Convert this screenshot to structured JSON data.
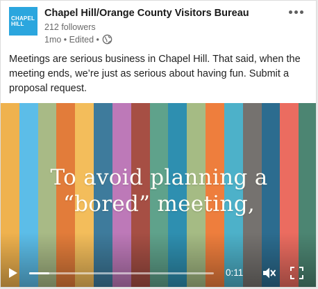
{
  "post": {
    "logo_text_line1": "CHAPEL",
    "logo_text_line2": "HILL",
    "author_name": "Chapel Hill/Orange County Visitors Bureau",
    "followers": "212 followers",
    "meta": "1mo • Edited •",
    "text": "Meetings are serious business in Chapel Hill. That said, when the meeting ends, we’re just as serious about having fun. Submit a proposal request."
  },
  "video": {
    "caption_line1": "To avoid planning a",
    "caption_line2": "“bored” meeting,",
    "time": "0:11",
    "progress": 0.11,
    "stripe_colors": [
      "#efb24e",
      "#5cbde8",
      "#a8ba86",
      "#e27c3a",
      "#f3bd5b",
      "#3e7b9c",
      "#bd79b8",
      "#a64f44",
      "#5fa28b",
      "#2e8fb0",
      "#a5bb84",
      "#ee7e3d",
      "#4db1c9",
      "#75726f",
      "#2c6c8f",
      "#eb6c60",
      "#4c8572"
    ]
  },
  "colors": {
    "logo_bg": "#2ba6de",
    "muted_text": "#6a6a6a"
  },
  "icons": [
    "globe-icon",
    "more-icon",
    "play-icon",
    "mute-icon",
    "fullscreen-icon"
  ]
}
